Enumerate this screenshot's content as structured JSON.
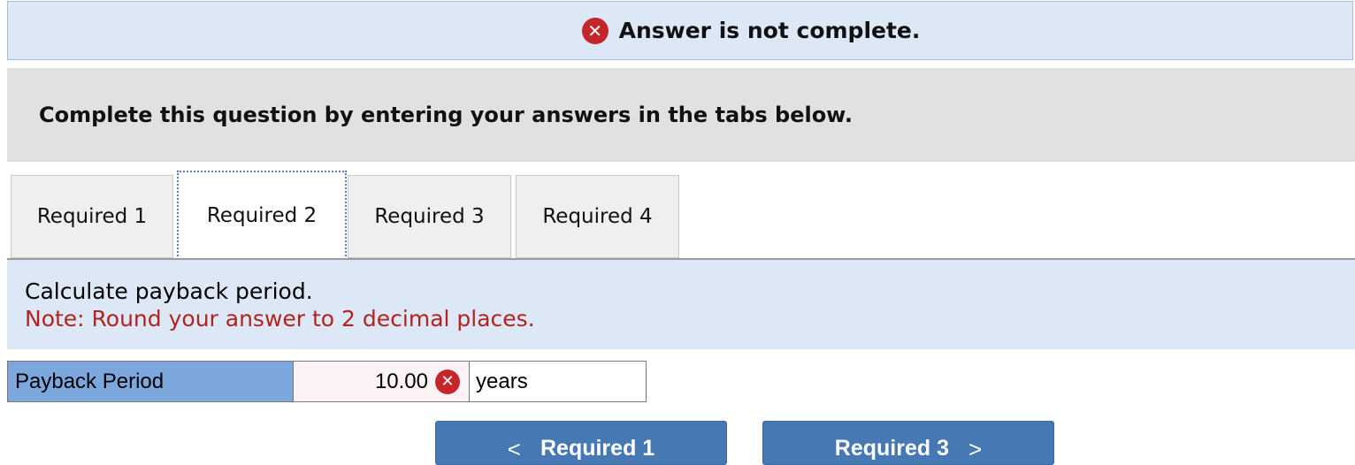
{
  "status": {
    "message": "Answer is not complete.",
    "icon": "x-circle-icon",
    "icon_color": "#c3272b"
  },
  "instructions": "Complete this question by entering your answers in the tabs below.",
  "tabs": [
    {
      "label": "Required 1"
    },
    {
      "label": "Required 2",
      "active": true
    },
    {
      "label": "Required 3"
    },
    {
      "label": "Required 4"
    }
  ],
  "prompt": {
    "text": "Calculate payback period.",
    "note": "Note: Round your answer to 2 decimal places."
  },
  "answer": {
    "label": "Payback Period",
    "value": "10.00",
    "unit": "years",
    "status": "incorrect"
  },
  "navigation": {
    "prev_label": "Required 1",
    "next_label": "Required 3",
    "prev_icon": "chevron-left-icon",
    "next_icon": "chevron-right-icon"
  },
  "colors": {
    "banner_bg": "#dde8f6",
    "label_bg": "#7ba7dc",
    "note": "#b2231f",
    "button_bg": "#4678b3"
  }
}
